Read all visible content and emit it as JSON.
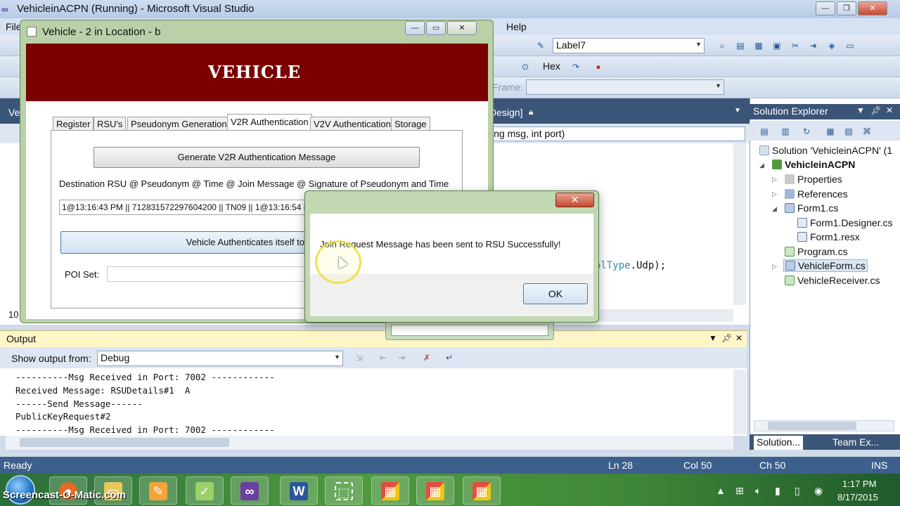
{
  "vs": {
    "title": "VehicleinACPN (Running) - Microsoft Visual Studio",
    "menu": {
      "file": "File",
      "help": "Help"
    },
    "toolbar": {
      "label_combo": "Label7",
      "hex": "Hex",
      "frame_label": "Frame:"
    },
    "editor": {
      "tab_label": "Design]",
      "nav_combo": "ing msg, int port)",
      "code_suffix_kw": "olType",
      "code_suffix": ".Udp);",
      "left_tab": "Ve",
      "zoom": "10"
    },
    "solution_explorer": {
      "title": "Solution Explorer",
      "items": [
        {
          "label": "Solution 'VehicleinACPN' (1"
        },
        {
          "label": "VehicleinACPN"
        },
        {
          "label": "Properties"
        },
        {
          "label": "References"
        },
        {
          "label": "Form1.cs"
        },
        {
          "label": "Form1.Designer.cs"
        },
        {
          "label": "Form1.resx"
        },
        {
          "label": "Program.cs"
        },
        {
          "label": "VehicleForm.cs"
        },
        {
          "label": "VehicleReceiver.cs"
        }
      ],
      "tabs": [
        "Solution...",
        "Team Ex..."
      ]
    },
    "output": {
      "title": "Output",
      "show_from_label": "Show output from:",
      "source": "Debug",
      "lines": [
        "----------Msg Received in Port: 7002 ------------",
        "Received Message: RSUDetails#1  A",
        "------Send Message------",
        "PublicKeyRequest#2",
        "----------Msg Received in Port: 7002 ------------"
      ]
    },
    "status": {
      "ready": "Ready",
      "ln": "Ln 28",
      "col": "Col 50",
      "ch": "Ch 50",
      "ins": "INS"
    }
  },
  "vehicle_form": {
    "title": "Vehicle - 2 in Location - b",
    "banner": "VEHICLE",
    "tabs": [
      "Register",
      "RSU's",
      "Pseudonym Generation",
      "V2R Authentication",
      "V2V Authentication",
      "Storage"
    ],
    "generate_button": "Generate V2R Authentication Message",
    "dest_label": "Destination RSU @ Pseudonym @ Time @ Join Message @ Signature of Pseudonym and Time",
    "message_value": "1@13:16:43 PM || 712831572297604200 || TN09 || 1@13:16:54 P",
    "auth_button": "Vehicle Authenticates itself to",
    "poi_label": "POI Set:"
  },
  "message_box": {
    "text": "Join Request Message has been sent to RSU Successfully!",
    "ok": "OK",
    "close": "✕"
  },
  "taskbar": {
    "time": "1:17 PM",
    "date": "8/17/2015",
    "watermark": "Screencast-O-Matic.com"
  },
  "colors": {
    "banner": "#7b0000",
    "vs_chrome": "#3b5578",
    "status_bar": "#3c5f8c",
    "output_header": "#fff6c8"
  }
}
